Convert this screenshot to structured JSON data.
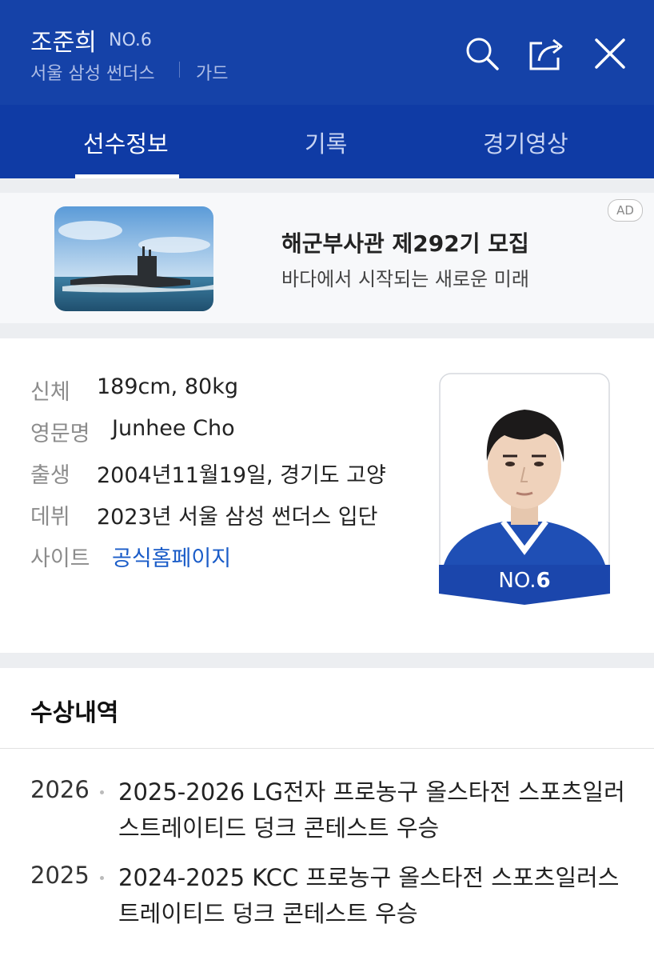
{
  "header": {
    "player_name": "조준희",
    "player_number": "NO.6",
    "team": "서울 삼성 썬더스",
    "position": "가드",
    "icons": [
      "search-icon",
      "share-icon",
      "close-icon"
    ]
  },
  "tabs": [
    {
      "label": "선수정보",
      "active": true
    },
    {
      "label": "기록",
      "active": false
    },
    {
      "label": "경기영상",
      "active": false
    }
  ],
  "ad": {
    "badge": "AD",
    "title": "해군부사관 제292기 모집",
    "subtitle": "바다에서 시작되는 새로운 미래"
  },
  "profile": {
    "rows": [
      {
        "label": "신체",
        "value": "189cm, 80kg"
      },
      {
        "label": "영문명",
        "value": "Junhee Cho"
      },
      {
        "label": "출생",
        "value": "2004년11월19일, 경기도 고양"
      },
      {
        "label": "데뷔",
        "value": "2023년 서울 삼성 썬더스 입단"
      },
      {
        "label": "사이트",
        "value": "공식홈페이지"
      }
    ],
    "card_number_prefix": "NO.",
    "card_number": "6"
  },
  "awards": {
    "title": "수상내역",
    "items": [
      {
        "year": "2026",
        "text": "2025-2026 LG전자 프로농구 올스타전 스포츠일러스트레이티드 덩크 콘테스트 우승"
      },
      {
        "year": "2025",
        "text": "2024-2025 KCC 프로농구 올스타전 스포츠일러스트레이티드 덩크 콘테스트 우승"
      }
    ]
  },
  "colors": {
    "header_bg": "#1542a8",
    "tab_bg": "#0f3ba5",
    "link": "#1a5cc8",
    "card_badge": "#1b46ac"
  }
}
